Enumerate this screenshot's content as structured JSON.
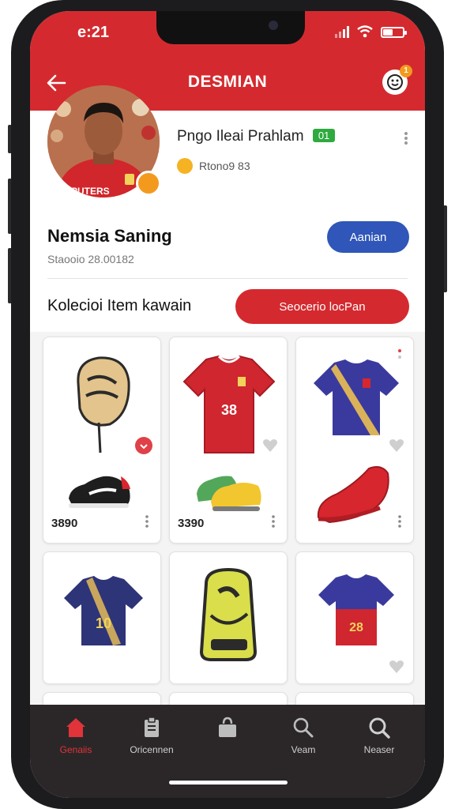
{
  "status_bar": {
    "time": "e:21"
  },
  "header": {
    "title": "DESMIAN",
    "notification_count": "1",
    "accent_color": "#d42a2f"
  },
  "profile": {
    "name": "Pngo Ileai Prahlam",
    "level_badge": "01",
    "points": "Rtono9 83",
    "photo": "profile-photo"
  },
  "team": {
    "name": "Nemsia Saning",
    "subtitle": "Staooio 28.00182",
    "action_label": "Aanian"
  },
  "collection": {
    "title": "Kolecioi Item kawain",
    "search_label": "Seocerio locPan"
  },
  "items": [
    {
      "icon": "baseball-glove-sneaker",
      "price": "3890",
      "favorited": true
    },
    {
      "icon": "red-jersey-boots",
      "price": "3390",
      "favorited": false
    },
    {
      "icon": "blue-jersey-red-shoe",
      "price": "",
      "favorited": false
    },
    {
      "icon": "navy-jersey-10",
      "price": "",
      "favorited": false
    },
    {
      "icon": "yellow-backpack",
      "price": "",
      "favorited": false
    },
    {
      "icon": "navy-red-jersey-28",
      "price": "",
      "favorited": false
    }
  ],
  "jersey_numbers": {
    "red_jersey": "38",
    "navy_jersey": "10",
    "navy_red_jersey": "28"
  },
  "bottom_nav": [
    {
      "label": "Genaiis",
      "icon": "home-icon",
      "active": true
    },
    {
      "label": "Oricennen",
      "icon": "clipboard-icon",
      "active": false
    },
    {
      "label": "",
      "icon": "bag-icon",
      "active": false
    },
    {
      "label": "Veam",
      "icon": "search-icon",
      "active": false
    },
    {
      "label": "Neaser",
      "icon": "search-icon",
      "active": false
    }
  ],
  "colors": {
    "primary_red": "#d42a2f",
    "action_blue": "#2f56b8",
    "nav_bg": "#2b2728"
  }
}
